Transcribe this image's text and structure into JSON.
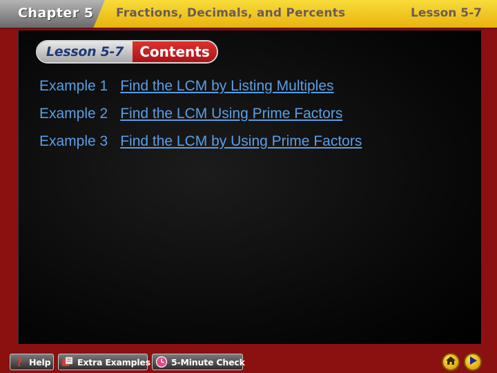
{
  "header": {
    "chapter": "Chapter 5",
    "title": "Fractions, Decimals, and Percents",
    "lesson": "Lesson 5-7"
  },
  "contents_badge": {
    "lesson": "Lesson 5-7",
    "contents": "Contents"
  },
  "examples": [
    {
      "label": "Example 1",
      "title": "Find the LCM by Listing Multiples"
    },
    {
      "label": "Example 2",
      "title": "Find the LCM Using Prime Factors"
    },
    {
      "label": "Example 3",
      "title": "Find the LCM by Using Prime Factors"
    }
  ],
  "footer": {
    "help": "Help",
    "extra_examples": "Extra Examples",
    "five_minute_check": "5-Minute Check",
    "icons": {
      "help": "question-mark-icon",
      "extra_examples": "examples-icon",
      "five_minute_check": "clock-icon",
      "home": "home-icon",
      "next": "play-arrow-icon"
    }
  },
  "colors": {
    "background": "#8b1010",
    "header": "#f0c424",
    "link": "#5b9fe6",
    "badge_red": "#c4201f",
    "badge_navy": "#1e3a78"
  }
}
